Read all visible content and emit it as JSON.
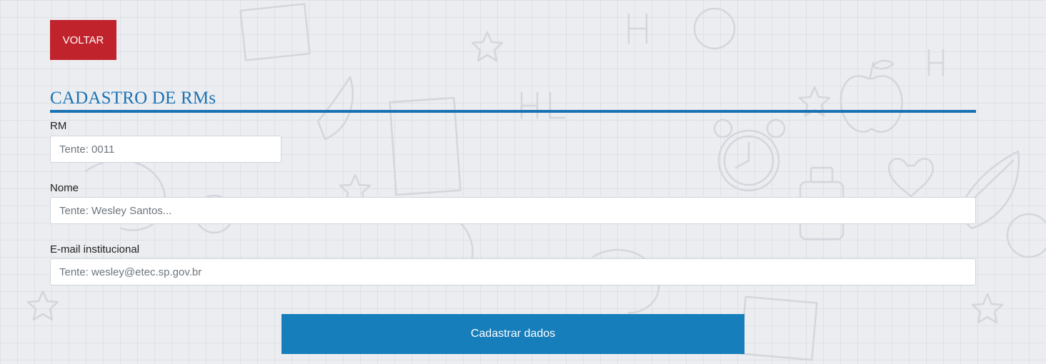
{
  "header": {
    "back_label": "VOLTAR"
  },
  "form": {
    "title": "CADASTRO DE RMs",
    "rm": {
      "label": "RM",
      "placeholder": "Tente: 0011",
      "value": ""
    },
    "nome": {
      "label": "Nome",
      "placeholder": "Tente: Wesley Santos...",
      "value": ""
    },
    "email": {
      "label": "E-mail institucional",
      "placeholder": "Tente: wesley@etec.sp.gov.br",
      "value": ""
    },
    "submit_label": "Cadastrar dados"
  },
  "colors": {
    "back_button": "#c1232c",
    "accent": "#1a72b4",
    "submit_button": "#167ebb",
    "background": "#ecedf0"
  },
  "icons": {
    "background_doodles": [
      "clock-icon",
      "apple-icon",
      "star-icon",
      "leaf-icon",
      "heart-icon",
      "bottle-icon",
      "pencil-icon"
    ]
  }
}
